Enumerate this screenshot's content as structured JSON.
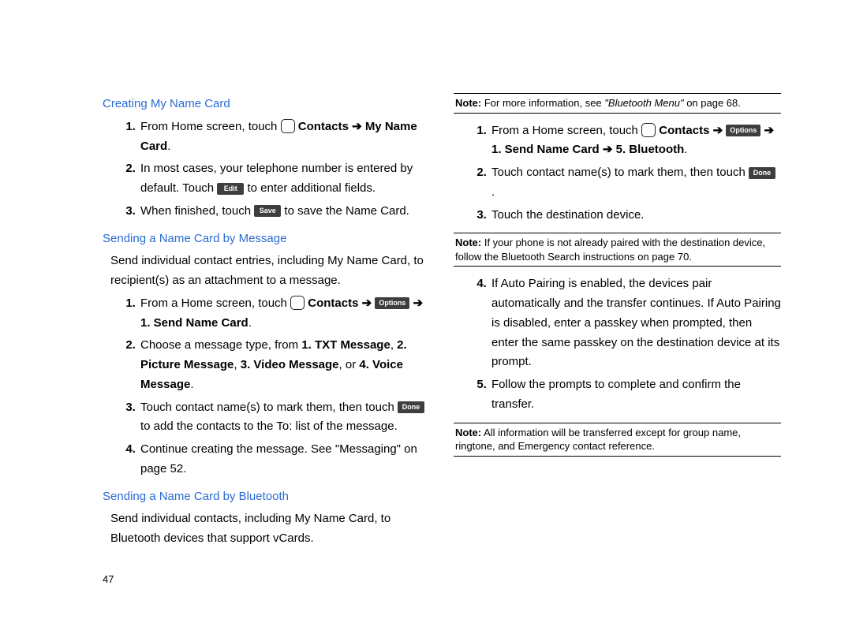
{
  "pageNumber": "47",
  "arrow": "➔",
  "buttons": {
    "edit": "Edit",
    "save": "Save",
    "options": "Options",
    "done": "Done"
  },
  "left": {
    "sec1": {
      "title": "Creating My Name Card",
      "s1a": "From Home screen, touch ",
      "s1b_bold": "Contacts ➔ My Name Card",
      "s1c": ".",
      "s2a": "In most cases, your telephone number is entered by default.  Touch ",
      "s2b": " to enter additional fields.",
      "s3a": "When finished, touch ",
      "s3b": " to save the Name Card."
    },
    "sec2": {
      "title": "Sending a Name Card by Message",
      "intro": "Send individual contact entries, including My Name Card, to recipient(s) as an attachment to a message.",
      "s1a": "From a Home screen, touch ",
      "s1b_bold": "Contacts ➔ ",
      "s1c_arrow": " ➔ ",
      "s1d_bold": "1. Send Name Card",
      "s1e": ".",
      "s2a": "Choose a message type, from ",
      "s2b_bold": "1. TXT Message",
      "s2c": ", ",
      "s2d_bold": "2. Picture Message",
      "s2e": ", ",
      "s2f_bold": "3. Video Message",
      "s2g": ", or ",
      "s2h_bold": "4. Voice Message",
      "s2i": ".",
      "s3a": "Touch contact name(s) to mark them, then touch ",
      "s3b": " to add the contacts to the To: list of the message.",
      "s4": "Continue creating the message. See \"Messaging\" on page 52."
    },
    "sec3": {
      "title": "Sending a Name Card by Bluetooth",
      "intro": "Send individual contacts, including My Name Card, to Bluetooth devices that support vCards."
    }
  },
  "right": {
    "note1a": "Note:",
    "note1b": " For more information, see ",
    "note1c_ital": "\"Bluetooth Menu\"",
    "note1d": " on page 68.",
    "s1a": "From a Home screen, touch ",
    "s1b_bold": "Contacts ➔ ",
    "s1c_arrow": " ➔ ",
    "s1d_bold": "1. Send Name Card ➔ 5. Bluetooth",
    "s1e": ".",
    "s2a": "Touch contact name(s) to mark them, then touch ",
    "s2b": " .",
    "s3": "Touch the destination device.",
    "note2a": "Note:",
    "note2b": " If your phone is not already paired with the destination device, follow the Bluetooth Search instructions on page 70.",
    "s4": "If Auto Pairing is enabled, the devices pair automatically and the transfer continues.  If Auto Pairing is disabled, enter a passkey when prompted, then enter the same passkey on the destination device at its prompt.",
    "s5": "Follow the prompts to complete and confirm the transfer.",
    "note3a": "Note:",
    "note3b": "  All information will be transferred except for group name, ringtone, and Emergency contact reference."
  }
}
